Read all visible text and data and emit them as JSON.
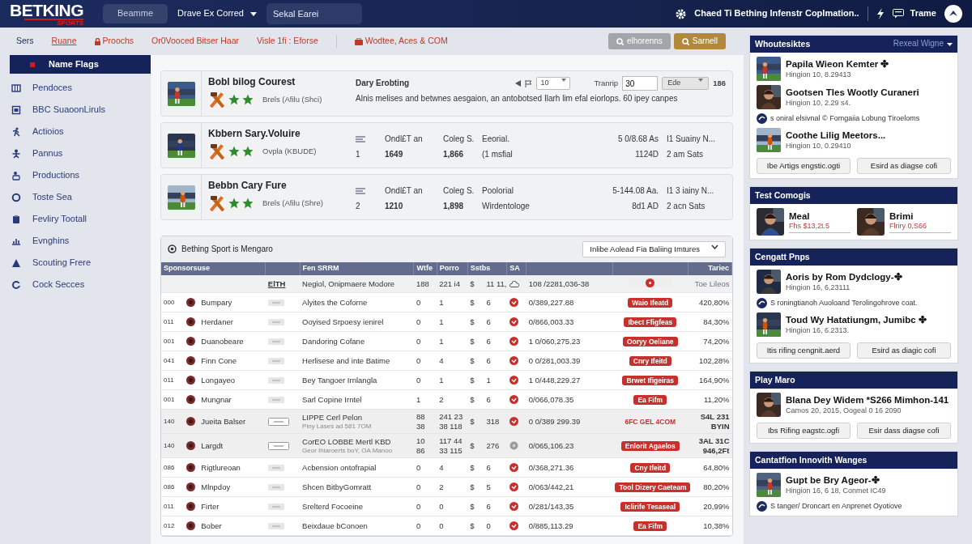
{
  "header": {
    "logo": "BETKING",
    "logo_sub": "SPORTS",
    "menu_button": "Beamme",
    "dropdown": "Drave Ex Corred",
    "search": {
      "placeholder": "Sekal Earei"
    },
    "notice": "Chaed Ti Bething Infenstr Coplmation..",
    "user": "Trame"
  },
  "subnav": {
    "items": [
      {
        "label": "Sers",
        "kind": "home",
        "selected": false
      },
      {
        "label": "Ruane",
        "kind": "link",
        "selected": true
      },
      {
        "label": "Proochs",
        "kind": "lock",
        "selected": false
      },
      {
        "label": "Or0Vooced Bitser Haar",
        "kind": "link",
        "selected": false
      },
      {
        "label": "Visle 1fi : Eforse",
        "kind": "link",
        "selected": false
      },
      {
        "label": "Wodtee, Aces & COM",
        "kind": "bag",
        "selected": false
      }
    ],
    "buttons": [
      {
        "label": "elhorenns",
        "kind": "secondary"
      },
      {
        "label": "Sarnell",
        "kind": "gold"
      }
    ]
  },
  "sidebar": {
    "items": [
      {
        "label": "Name Flags",
        "selected": true
      },
      {
        "label": "Pendoces",
        "selected": false
      },
      {
        "label": "BBC SuaoonLiruls",
        "selected": false
      },
      {
        "label": "Actioios",
        "selected": false
      },
      {
        "label": "Pannus",
        "selected": false
      },
      {
        "label": "Productions",
        "selected": false
      },
      {
        "label": "Toste Sea",
        "selected": false
      },
      {
        "label": "Fevliry Tootall",
        "selected": false
      },
      {
        "label": "Evnghins",
        "selected": false
      },
      {
        "label": "Scouting Frere",
        "selected": false
      },
      {
        "label": "Cock Secces",
        "selected": false
      }
    ]
  },
  "featured": [
    {
      "kind": "controls",
      "title": "Bobl bilog Courest",
      "subtitle": "Brels (Afilu (Shci)",
      "heading": "Dary Erobting",
      "description": "Alnis melises and betwnes aesgaion, an antobotsed Ilarh lim efal eiorlops. 60 ipey canpes",
      "controls": {
        "select": "10",
        "label": "Tranrip",
        "input": "30",
        "select2": "Ede",
        "total": "186"
      }
    },
    {
      "kind": "stats",
      "title": "Kbbern Sary.Voluire",
      "subtitle": "Ovpla (KBUDE)",
      "rank": "1",
      "stats": [
        [
          "Ondl£T an",
          "1649"
        ],
        [
          "Coleg S.",
          "1,866"
        ],
        [
          "Eeorial.",
          "(1 msfial"
        ],
        [
          "5 0/8.68 As",
          "1124D"
        ],
        [
          "I1 Suainy N...",
          "2 am Sats"
        ]
      ]
    },
    {
      "kind": "stats",
      "title": "Bebbn Cary Fure",
      "subtitle": "Brels (Afilu (Shre)",
      "rank": "2",
      "stats": [
        [
          "Ondl£T an",
          "1210"
        ],
        [
          "Coleg S.",
          "1,898"
        ],
        [
          "Poolorial",
          "Wirdentologe"
        ],
        [
          "5-144.08 Aa.",
          "8d1 AD"
        ],
        [
          "I1 3 iainy N...",
          "2 acn Sats"
        ]
      ]
    }
  ],
  "table_panel": {
    "title": "Bething Sport is Mengaro",
    "filter": "Inlibe Aolead Fia Baliing Imtures",
    "columns": [
      "Sponsorsuse",
      "Fen SRRM",
      "Wtfe",
      "Porro",
      "Sstbs",
      "SA",
      "Tariec"
    ],
    "rows": [
      {
        "kind": "summary",
        "tag": "ElTH",
        "desc": "Negiol, Onipmaere Modore",
        "c1": "188",
        "c2": "221 i4",
        "cur": "$",
        "c3": "11 11,",
        "status": {
          "kind": "cloud"
        },
        "odds": "108 /2281,036-38",
        "badge": {
          "kind": "dot"
        },
        "pct": "Toe Lileos"
      },
      {
        "kind": "single",
        "num": "000",
        "name": "Bumpary",
        "desc": "Alyites the Coforne",
        "c1": "0",
        "c2": "1",
        "cur": "$",
        "c3": "6",
        "status": {
          "kind": "alert"
        },
        "odds": "0/389,227.88",
        "badge": {
          "kind": "pill",
          "text": "Waio Ifeatd"
        },
        "pct": "420,80%"
      },
      {
        "kind": "single",
        "num": "011",
        "name": "Herdaner",
        "desc": "Ooyised Srpoesy ienirel",
        "c1": "0",
        "c2": "1",
        "cur": "$",
        "c3": "6",
        "status": {
          "kind": "alert"
        },
        "odds": "0/866,003.33",
        "badge": {
          "kind": "pill",
          "text": "Ibect Ffigfeas"
        },
        "pct": "84,30%"
      },
      {
        "kind": "single",
        "num": "001",
        "name": "Duanobeare",
        "desc": "Dandoring Cofane",
        "c1": "0",
        "c2": "1",
        "cur": "$",
        "c3": "6",
        "status": {
          "kind": "alert"
        },
        "odds": "1 0/060,275.23",
        "badge": {
          "kind": "pill",
          "text": "Ooryy Oeliane"
        },
        "pct": "74,20%"
      },
      {
        "kind": "single",
        "num": "041",
        "name": "Finn Cone",
        "desc": "Herlisese and inte Batime",
        "c1": "0",
        "c2": "4",
        "cur": "$",
        "c3": "6",
        "status": {
          "kind": "alert"
        },
        "odds": "0 0/281,003.39",
        "badge": {
          "kind": "pill",
          "text": "Cnry Ifeitd"
        },
        "pct": "102,28%"
      },
      {
        "kind": "single",
        "num": "011",
        "name": "Longayeo",
        "desc": "Bey Tangoer Irnlangla",
        "c1": "0",
        "c2": "1",
        "cur": "$",
        "c3": "1",
        "status": {
          "kind": "alert"
        },
        "odds": "1 0/448,229.27",
        "badge": {
          "kind": "pill",
          "text": "Brwet Ifigeiras"
        },
        "pct": "164,90%"
      },
      {
        "kind": "single",
        "num": "001",
        "name": "Mungnar",
        "desc": "Sarl Copine Irntel",
        "c1": "1",
        "c2": "2",
        "cur": "$",
        "c3": "6",
        "status": {
          "kind": "alert"
        },
        "odds": "0/066,078.35",
        "badge": {
          "kind": "pill",
          "text": "Ea Fifm"
        },
        "pct": "11,20%"
      },
      {
        "kind": "double",
        "num": "140",
        "name": "Jueita Balser",
        "desc": "LIPPE Cerl Pelon",
        "note": "Piny Lases ad 581 7OM",
        "c1": "88",
        "c1b": "38",
        "c2": "241 23",
        "c2b": "38 118",
        "cur": "$",
        "c3": "318",
        "status": {
          "kind": "alert"
        },
        "odds": "0 0/389 299.39",
        "badge": {
          "kind": "text",
          "text": "6FC GEL 4COM"
        },
        "pct": "S4L 231",
        "pctb": "BYIN"
      },
      {
        "kind": "double",
        "num": "140",
        "name": "Largdt",
        "desc": "CorEO LOBBE Mertl KBD",
        "note": "Geor Ihiaroerts boY, OA Manoo",
        "c1": "10",
        "c1b": "86",
        "c2": "117 44",
        "c2b": "33 115",
        "cur": "$",
        "c3": "276",
        "status": {
          "kind": "muted"
        },
        "odds": "0/065,106.23",
        "badge": {
          "kind": "pill",
          "text": "Enlorit Agaelos"
        },
        "pct": "3AL 31C",
        "pctb": "946,2Ft"
      },
      {
        "kind": "single",
        "num": "086",
        "name": "Rigtlureoan",
        "desc": "Acbension ontofrapial",
        "c1": "0",
        "c2": "4",
        "cur": "$",
        "c3": "6",
        "status": {
          "kind": "alert"
        },
        "odds": "0/368,271.36",
        "badge": {
          "kind": "pill",
          "text": "Cny Ifeitd"
        },
        "pct": "64,80%"
      },
      {
        "kind": "single",
        "num": "086",
        "name": "Mlnpdoy",
        "desc": "Shcen BitbyGomratt",
        "c1": "0",
        "c2": "2",
        "cur": "$",
        "c3": "5",
        "status": {
          "kind": "alert"
        },
        "odds": "0/063/442,21",
        "badge": {
          "kind": "pill",
          "text": "Tool Dizery Caeteam"
        },
        "pct": "80,20%"
      },
      {
        "kind": "single",
        "num": "011",
        "name": "Firter",
        "desc": "Srelterd Focoeine",
        "c1": "0",
        "c2": "0",
        "cur": "$",
        "c3": "6",
        "status": {
          "kind": "alert"
        },
        "odds": "0/281/143,35",
        "badge": {
          "kind": "pill",
          "text": "Iclirife Tesaseal"
        },
        "pct": "20,99%"
      },
      {
        "kind": "single",
        "num": "012",
        "name": "Bober",
        "desc": "Beixdaue bConoen",
        "c1": "0",
        "c2": "0",
        "cur": "$",
        "c3": "0",
        "status": {
          "kind": "alert"
        },
        "odds": "0/885,113.29",
        "badge": {
          "kind": "pill",
          "text": "Ea Fifm"
        },
        "pct": "10,38%"
      }
    ]
  },
  "panels": [
    {
      "title": "Whoutesiktes",
      "link": "Rexeal Wigne",
      "items": [
        {
          "kind": "entry",
          "title": "Papila Wieon Kemter ✤",
          "meta": "Hingion 10, 8.29413"
        },
        {
          "kind": "entry",
          "title": "Gootsen Tles Wootly Curaneri",
          "meta": "Hingion 10, 2.29 s4."
        },
        {
          "kind": "note",
          "text": "s oniral elsivnal © Fomgaiia Lobung Tiroeloms"
        },
        {
          "kind": "entry",
          "title": "Coothe Lilig Meetors...",
          "meta": "Hingion 10, 0.29410"
        }
      ],
      "buttons": [
        "Ibe Artigs engstic.ogti",
        "Esird as diagse cofi"
      ]
    },
    {
      "title": "Test Comogis",
      "items": [
        {
          "kind": "person",
          "title": "Meal",
          "meta": "Fhs $13,2t.5"
        },
        {
          "kind": "person",
          "title": "Brimi",
          "meta": "Flriry 0,S66"
        }
      ]
    },
    {
      "title": "Cengatt Pnps",
      "items": [
        {
          "kind": "entry",
          "title": "Aoris by Rom Dydclogy-✤",
          "meta": "Hingion 16, 6,23111"
        },
        {
          "kind": "note",
          "text": "S roningtianoh Auoloand Terolingohrove coat."
        },
        {
          "kind": "entry",
          "title": "Toud Wy Hatatiungm, Jumibc ✤",
          "meta": "Hingion 16, 6.2313."
        }
      ],
      "buttons": [
        "Itis rifing cengnit.aerd",
        "Esird as diagic cofi"
      ]
    },
    {
      "title": "Play Maro",
      "items": [
        {
          "kind": "entry",
          "title": "Blana Dey Widem *S266 Mimhon-141",
          "meta": "Camos 20, 2015, Oogeal 0 16 2090"
        }
      ],
      "buttons": [
        "Ibs Rifing eagstc.ogfi",
        "Esir dass diagse cofi"
      ]
    },
    {
      "title": "Cantatfion Innovith Wanges",
      "items": [
        {
          "kind": "entry",
          "title": "Gupt be Bry Ageor-✤",
          "meta": "Hingion 16, 6 18, Conmet IC49"
        },
        {
          "kind": "note",
          "text": "S tanger/ Droncart en Anprenet Oyotiove"
        }
      ]
    }
  ]
}
